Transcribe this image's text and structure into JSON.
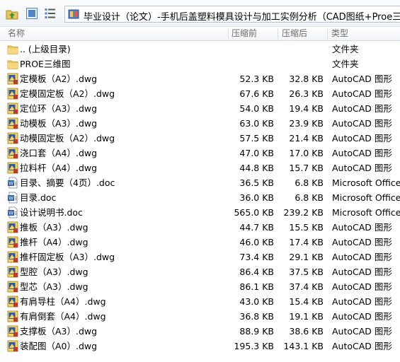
{
  "toolbar": {
    "path": "毕业设计（论文）-手机后盖塑料模具设计与加工实例分析（CAD图纸+Proe三维）.zi"
  },
  "columns": {
    "name": "名称",
    "size": "压缩前",
    "packed": "压缩后",
    "type": "类型"
  },
  "rows": [
    {
      "name": ".. (上级目录)",
      "size": "",
      "packed": "",
      "type": "文件夹",
      "icon": "folder-icon"
    },
    {
      "name": "PROE三维图",
      "size": "",
      "packed": "",
      "type": "文件夹",
      "icon": "folder-icon"
    },
    {
      "name": "定模板（A2）.dwg",
      "size": "52.3 KB",
      "packed": "32.8 KB",
      "type": "AutoCAD 图形",
      "icon": "dwg-file-icon"
    },
    {
      "name": "定模固定板（A2）.dwg",
      "size": "67.6 KB",
      "packed": "26.3 KB",
      "type": "AutoCAD 图形",
      "icon": "dwg-file-icon"
    },
    {
      "name": "定位环（A3）.dwg",
      "size": "54.0 KB",
      "packed": "19.4 KB",
      "type": "AutoCAD 图形",
      "icon": "dwg-file-icon"
    },
    {
      "name": "动模板（A3）.dwg",
      "size": "63.0 KB",
      "packed": "23.9 KB",
      "type": "AutoCAD 图形",
      "icon": "dwg-file-icon"
    },
    {
      "name": "动模固定板（A2）.dwg",
      "size": "57.5 KB",
      "packed": "21.4 KB",
      "type": "AutoCAD 图形",
      "icon": "dwg-file-icon"
    },
    {
      "name": "浇口套（A4）.dwg",
      "size": "47.0 KB",
      "packed": "17.0 KB",
      "type": "AutoCAD 图形",
      "icon": "dwg-file-icon"
    },
    {
      "name": "拉料杆（A4）.dwg",
      "size": "44.8 KB",
      "packed": "15.7 KB",
      "type": "AutoCAD 图形",
      "icon": "dwg-file-icon"
    },
    {
      "name": "目录、摘要（4页）.doc",
      "size": "36.5 KB",
      "packed": "6.8 KB",
      "type": "Microsoft Office",
      "icon": "doc-file-icon"
    },
    {
      "name": "目录.doc",
      "size": "36.0 KB",
      "packed": "6.8 KB",
      "type": "Microsoft Office",
      "icon": "doc-file-icon"
    },
    {
      "name": "设计说明书.doc",
      "size": "565.0 KB",
      "packed": "239.2 KB",
      "type": "Microsoft Office",
      "icon": "doc-file-icon"
    },
    {
      "name": "推板（A3）.dwg",
      "size": "44.7 KB",
      "packed": "15.5 KB",
      "type": "AutoCAD 图形",
      "icon": "dwg-file-icon"
    },
    {
      "name": "推杆（A4）.dwg",
      "size": "46.0 KB",
      "packed": "17.4 KB",
      "type": "AutoCAD 图形",
      "icon": "dwg-file-icon"
    },
    {
      "name": "推杆固定板（A3）.dwg",
      "size": "73.4 KB",
      "packed": "29.1 KB",
      "type": "AutoCAD 图形",
      "icon": "dwg-file-icon"
    },
    {
      "name": "型腔（A3）.dwg",
      "size": "86.4 KB",
      "packed": "37.5 KB",
      "type": "AutoCAD 图形",
      "icon": "dwg-file-icon"
    },
    {
      "name": "型芯（A3）.dwg",
      "size": "86.1 KB",
      "packed": "37.4 KB",
      "type": "AutoCAD 图形",
      "icon": "dwg-file-icon"
    },
    {
      "name": "有肩导柱（A4）.dwg",
      "size": "43.0 KB",
      "packed": "15.4 KB",
      "type": "AutoCAD 图形",
      "icon": "dwg-file-icon"
    },
    {
      "name": "有肩倒套（A4）.dwg",
      "size": "36.8 KB",
      "packed": "19.1 KB",
      "type": "AutoCAD 图形",
      "icon": "dwg-file-icon"
    },
    {
      "name": "支撑板（A3）.dwg",
      "size": "88.9 KB",
      "packed": "38.6 KB",
      "type": "AutoCAD 图形",
      "icon": "dwg-file-icon"
    },
    {
      "name": "装配图（A0）.dwg",
      "size": "195.3 KB",
      "packed": "143.1 KB",
      "type": "AutoCAD 图形",
      "icon": "dwg-file-icon"
    }
  ]
}
